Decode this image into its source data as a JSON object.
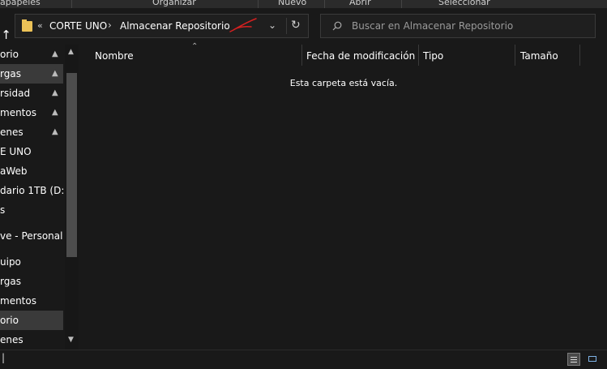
{
  "ribbon": {
    "groups": [
      "apapeles",
      "Organizar",
      "Nuevo",
      "Abrir",
      "Seleccionar"
    ]
  },
  "nav": {
    "up_glyph": "↑",
    "breadcrumb_more": "«",
    "breadcrumb": [
      "CORTE UNO",
      "Almacenar Repositorio"
    ],
    "chevron": "›",
    "dropdown_glyph": "⌄",
    "refresh_glyph": "↻"
  },
  "search": {
    "placeholder": "Buscar en Almacenar Repositorio",
    "value": ""
  },
  "sidebar": {
    "items": [
      {
        "label": "orio",
        "pinned": true
      },
      {
        "label": "rgas",
        "pinned": true
      },
      {
        "label": "rsidad",
        "pinned": true
      },
      {
        "label": "mentos",
        "pinned": true
      },
      {
        "label": "enes",
        "pinned": true
      },
      {
        "label": "E UNO",
        "pinned": false
      },
      {
        "label": "aWeb",
        "pinned": false
      },
      {
        "label": "dario 1TB (D:)",
        "pinned": false
      },
      {
        "label": "s",
        "pinned": false
      },
      {
        "label": "ve - Personal",
        "pinned": false
      },
      {
        "label": "uipo",
        "pinned": false
      },
      {
        "label": "rgas",
        "pinned": false
      },
      {
        "label": "mentos",
        "pinned": false
      },
      {
        "label": "orio",
        "pinned": false,
        "selected": true
      },
      {
        "label": "enes",
        "pinned": false
      }
    ],
    "pin_glyph": "📌"
  },
  "columns": [
    "Nombre",
    "Fecha de modificación",
    "Tipo",
    "Tamaño"
  ],
  "empty_message": "Esta carpeta está vacía.",
  "status": {
    "text": "|"
  },
  "colors": {
    "background": "#191919",
    "folder": "#ecc257",
    "annotation": "#d42020"
  }
}
